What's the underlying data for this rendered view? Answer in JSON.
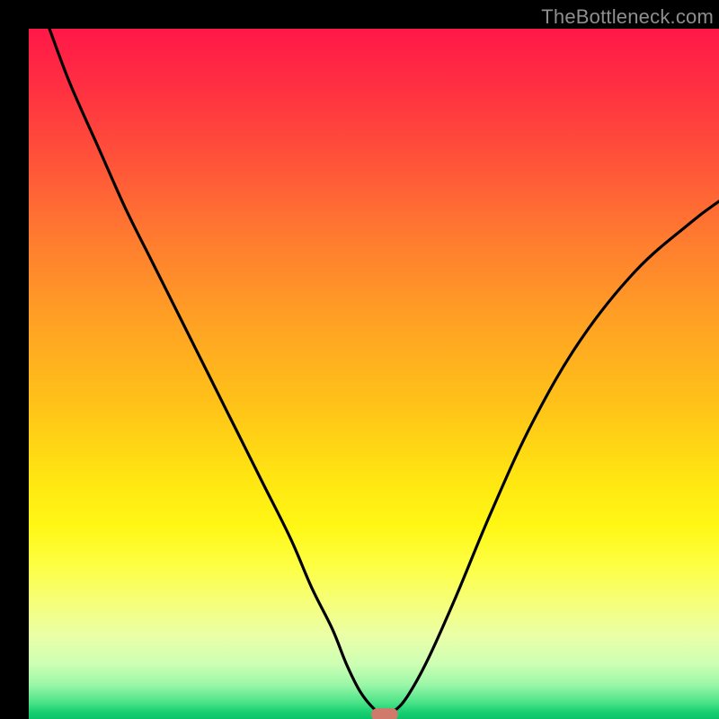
{
  "watermark": "TheBottleneck.com",
  "colors": {
    "background": "#000000",
    "gradient_top": "#ff1848",
    "gradient_bottom": "#08c468",
    "curve": "#000000",
    "marker": "#cf7a6a",
    "watermark_text": "#8e8e8e"
  },
  "chart_data": {
    "type": "line",
    "title": "",
    "xlabel": "",
    "ylabel": "",
    "xlim": [
      0,
      100
    ],
    "ylim": [
      0,
      100
    ],
    "grid": false,
    "legend": false,
    "series": [
      {
        "name": "bottleneck-curve",
        "x": [
          3,
          6,
          10,
          14,
          18,
          22,
          26,
          30,
          34,
          38,
          41,
          44,
          46,
          48,
          50,
          51.5,
          53,
          55,
          58,
          62,
          67,
          73,
          80,
          88,
          96,
          100
        ],
        "values": [
          100,
          92,
          83,
          74,
          66,
          58,
          50,
          42,
          34,
          26,
          19,
          13,
          8,
          4,
          1.5,
          0.7,
          1.2,
          3.5,
          9,
          18,
          30,
          43,
          55,
          65,
          72,
          75
        ]
      }
    ],
    "marker": {
      "x": 51.5,
      "y": 0.7
    },
    "gradient_stops": [
      {
        "pos": 0.0,
        "color": "#ff1848"
      },
      {
        "pos": 0.3,
        "color": "#ff7a30"
      },
      {
        "pos": 0.65,
        "color": "#ffe512"
      },
      {
        "pos": 0.88,
        "color": "#eaffa8"
      },
      {
        "pos": 1.0,
        "color": "#08c468"
      }
    ]
  }
}
